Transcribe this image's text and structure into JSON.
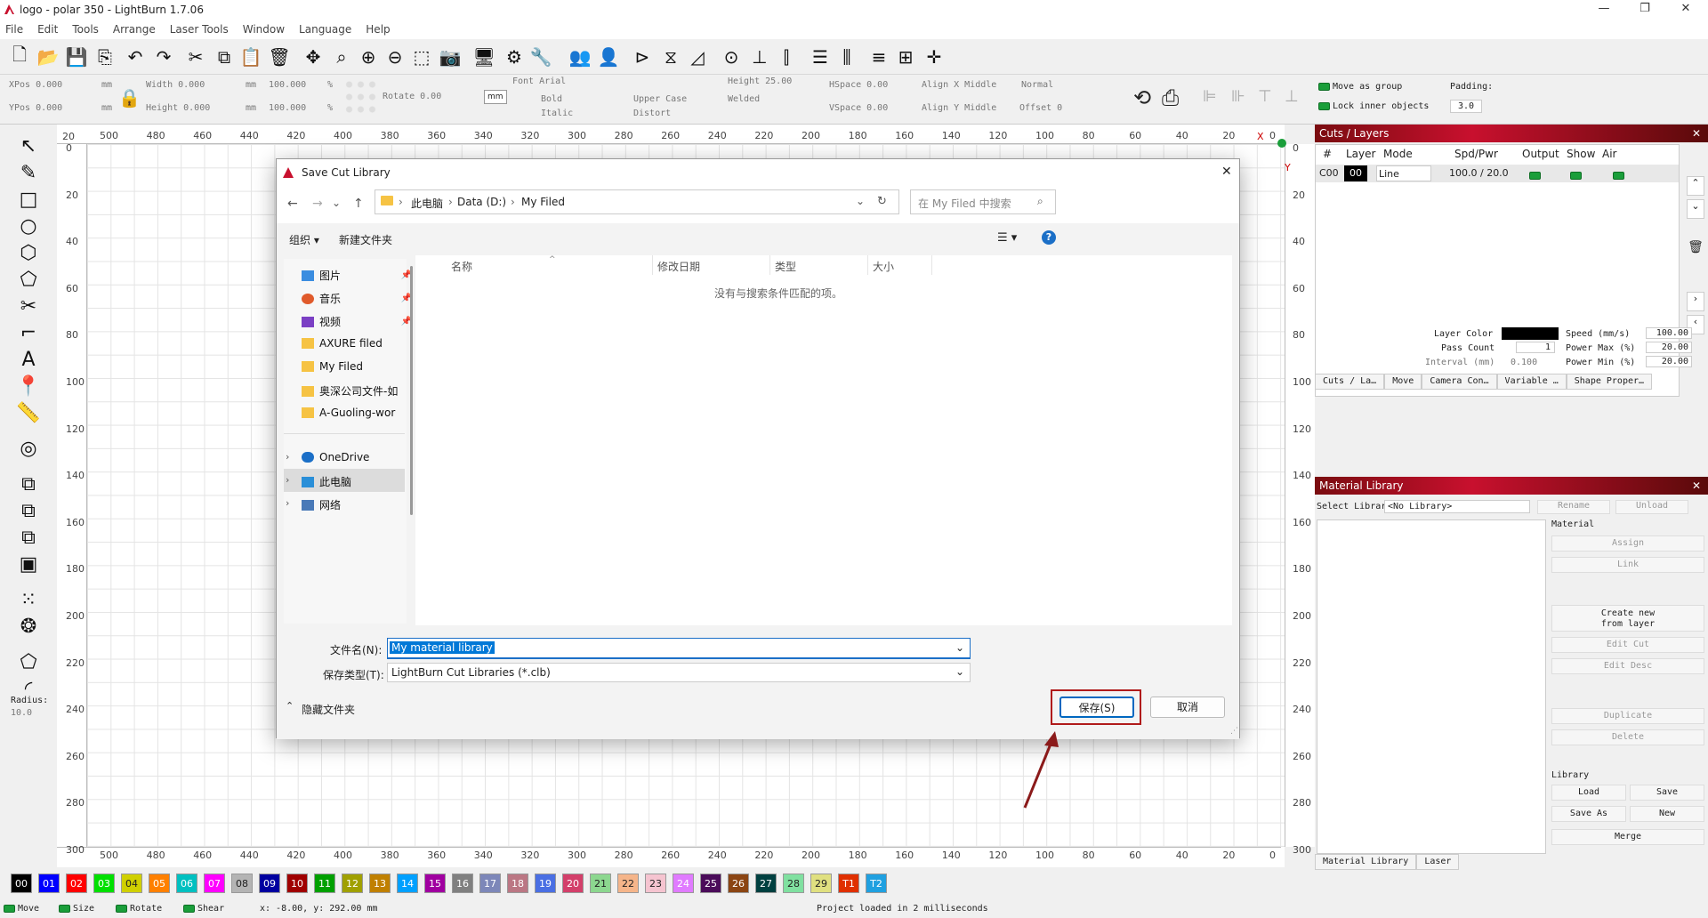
{
  "window": {
    "title": "logo - polar 350 - LightBurn 1.7.06"
  },
  "menu": [
    "File",
    "Edit",
    "Tools",
    "Arrange",
    "Laser Tools",
    "Window",
    "Language",
    "Help"
  ],
  "toolbar2": {
    "xpos": "XPos 0.000",
    "ypos": "YPos 0.000",
    "mm1": "mm",
    "mm2": "mm",
    "width": "Width 0.000",
    "height": "Height 0.000",
    "mm3": "mm",
    "mm4": "mm",
    "pct_w": "100.000",
    "pct_h": "100.000",
    "pct1": "%",
    "pct2": "%",
    "rotate": "Rotate 0.00",
    "mm_unit": "mm",
    "font": "Font Arial",
    "font_height": "Height 25.00",
    "bold": "Bold",
    "italic": "Italic",
    "upper": "Upper Case",
    "distort": "Distort",
    "welded": "Welded",
    "hspace": "HSpace 0.00",
    "vspace": "VSpace 0.00",
    "alignx": "Align X Middle",
    "aligny": "Align Y Middle",
    "normal": "Normal",
    "offset": "Offset 0",
    "move_group": "Move as group",
    "lock_inner": "Lock inner objects",
    "padding": "Padding:",
    "padding_val": "3.0"
  },
  "left_tools": {
    "radius_label": "Radius:",
    "radius_val": "10.0"
  },
  "rulers": {
    "top": [
      "500",
      "480",
      "460",
      "440",
      "420",
      "400",
      "380",
      "360",
      "340",
      "320",
      "300",
      "280",
      "260",
      "240",
      "220",
      "200",
      "180",
      "160",
      "140",
      "120",
      "100",
      "80",
      "60",
      "40",
      "20",
      "0"
    ],
    "top_left": "20",
    "left": [
      "0",
      "20",
      "40",
      "60",
      "80",
      "100",
      "120",
      "140",
      "160",
      "180",
      "200",
      "220",
      "240",
      "260",
      "280",
      "300"
    ],
    "right": [
      "0",
      "20",
      "40",
      "60",
      "80",
      "100",
      "120",
      "140",
      "160",
      "180",
      "200",
      "220",
      "240",
      "260",
      "280",
      "300"
    ],
    "x_marker": "X",
    "y_marker": "Y"
  },
  "cuts_layers": {
    "title": "Cuts / Layers",
    "headers": [
      "#",
      "Layer",
      "Mode",
      "Spd/Pwr",
      "Output",
      "Show",
      "Air"
    ],
    "row": {
      "num": "C00",
      "layer": "00",
      "mode": "Line",
      "spdpwr": "100.0 / 20.0"
    },
    "layer_color": "Layer Color",
    "pass_count": "Pass Count",
    "pass_val": "1",
    "interval": "Interval (mm)",
    "interval_val": "0.100",
    "speed": "Speed (mm/s)",
    "speed_val": "100.00",
    "pmax": "Power Max (%)",
    "pmax_val": "20.00",
    "pmin": "Power Min (%)",
    "pmin_val": "20.00",
    "tabs": [
      "Cuts / La…",
      "Move",
      "Camera Con…",
      "Variable …",
      "Shape Proper…"
    ]
  },
  "material": {
    "title": "Material Library",
    "select": "Select Library",
    "lib_val": "<No Library>",
    "rename": "Rename",
    "unload": "Unload",
    "material_lbl": "Material",
    "assign": "Assign",
    "link": "Link",
    "create": "Create new from layer",
    "edit_cut": "Edit Cut",
    "edit_desc": "Edit Desc",
    "duplicate": "Duplicate",
    "delete": "Delete",
    "library_lbl": "Library",
    "load": "Load",
    "save": "Save",
    "save_as": "Save As",
    "new": "New",
    "merge": "Merge",
    "tabs": [
      "Material Library",
      "Laser"
    ]
  },
  "palette": [
    {
      "label": "00",
      "color": "#000000"
    },
    {
      "label": "01",
      "color": "#0000ff"
    },
    {
      "label": "02",
      "color": "#ff0000"
    },
    {
      "label": "03",
      "color": "#00e000"
    },
    {
      "label": "04",
      "color": "#d0d000"
    },
    {
      "label": "05",
      "color": "#ff8000"
    },
    {
      "label": "06",
      "color": "#00c0c0"
    },
    {
      "label": "07",
      "color": "#ff00ff"
    },
    {
      "label": "08",
      "color": "#b4b4b4"
    },
    {
      "label": "09",
      "color": "#0000a0"
    },
    {
      "label": "10",
      "color": "#a00000"
    },
    {
      "label": "11",
      "color": "#00a000"
    },
    {
      "label": "12",
      "color": "#a0a000"
    },
    {
      "label": "13",
      "color": "#c08000"
    },
    {
      "label": "14",
      "color": "#00a0ff"
    },
    {
      "label": "15",
      "color": "#a000a0"
    },
    {
      "label": "16",
      "color": "#808080"
    },
    {
      "label": "17",
      "color": "#7d87b9"
    },
    {
      "label": "18",
      "color": "#bb7784"
    },
    {
      "label": "19",
      "color": "#4a6fe3"
    },
    {
      "label": "20",
      "color": "#d33f6a"
    },
    {
      "label": "21",
      "color": "#8cd78f"
    },
    {
      "label": "22",
      "color": "#f5b58a"
    },
    {
      "label": "23",
      "color": "#f5c4d0"
    },
    {
      "label": "24",
      "color": "#e07bff"
    },
    {
      "label": "25",
      "color": "#4b0c5a"
    },
    {
      "label": "26",
      "color": "#8b4513"
    },
    {
      "label": "27",
      "color": "#004040"
    },
    {
      "label": "28",
      "color": "#80e0a0"
    },
    {
      "label": "29",
      "color": "#e0e080"
    },
    {
      "label": "T1",
      "color": "#e03000"
    },
    {
      "label": "T2",
      "color": "#20a0e0"
    }
  ],
  "status": {
    "move": "Move",
    "size": "Size",
    "rotate": "Rotate",
    "shear": "Shear",
    "coords": "x: -8.00, y: 292.00 mm",
    "msg": "Project loaded in 2 milliseconds"
  },
  "dialog": {
    "title": "Save Cut Library",
    "path": [
      "此电脑",
      "Data (D:)",
      "My Filed"
    ],
    "search_placeholder": "在 My Filed 中搜索",
    "organize": "组织 ▾",
    "new_folder": "新建文件夹",
    "nav": [
      "图片",
      "音乐",
      "视频",
      "AXURE filed",
      "My Filed",
      "奥深公司文件-如",
      "A-Guoling-wor",
      "OneDrive",
      "此电脑",
      "网络"
    ],
    "columns": [
      "名称",
      "修改日期",
      "类型",
      "大小"
    ],
    "empty_msg": "没有与搜索条件匹配的项。",
    "filename_label": "文件名(N):",
    "filename_val": "My material library",
    "type_label": "保存类型(T):",
    "type_val": "LightBurn Cut Libraries (*.clb)",
    "hide_folders": "隐藏文件夹",
    "save_btn": "保存(S)",
    "cancel_btn": "取消"
  }
}
